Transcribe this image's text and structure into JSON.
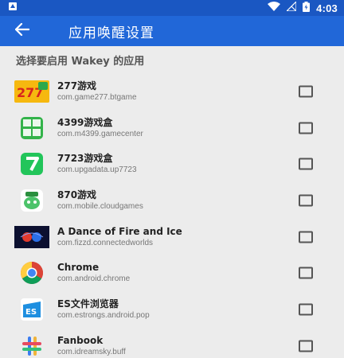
{
  "status_bar": {
    "time": "4:03",
    "icons": [
      "notification-icon",
      "wifi-icon",
      "no-signal-icon",
      "battery-icon"
    ]
  },
  "toolbar": {
    "back_icon": "arrow-back-icon",
    "title": "应用唤醒设置"
  },
  "section": {
    "header": "选择要启用 Wakey 的应用"
  },
  "apps": [
    {
      "name": "277游戏",
      "package": "com.game277.btgame",
      "icon": "app-277-icon",
      "checked": false
    },
    {
      "name": "4399游戏盒",
      "package": "com.m4399.gamecenter",
      "icon": "app-4399-icon",
      "checked": false
    },
    {
      "name": "7723游戏盒",
      "package": "com.upgadata.up7723",
      "icon": "app-7723-icon",
      "checked": false
    },
    {
      "name": "870游戏",
      "package": "com.mobile.cloudgames",
      "icon": "app-870-icon",
      "checked": false
    },
    {
      "name": "A Dance of Fire and Ice",
      "package": "com.fizzd.connectedworlds",
      "icon": "app-adofai-icon",
      "checked": false
    },
    {
      "name": "Chrome",
      "package": "com.android.chrome",
      "icon": "chrome-icon",
      "checked": false
    },
    {
      "name": "ES文件浏览器",
      "package": "com.estrongs.android.pop",
      "icon": "es-file-explorer-icon",
      "checked": false
    },
    {
      "name": "Fanbook",
      "package": "com.idreamsky.buff",
      "icon": "fanbook-icon",
      "checked": false
    }
  ],
  "colors": {
    "status_bar": "#1a57c2",
    "toolbar": "#2167d8",
    "background": "#ececec"
  }
}
